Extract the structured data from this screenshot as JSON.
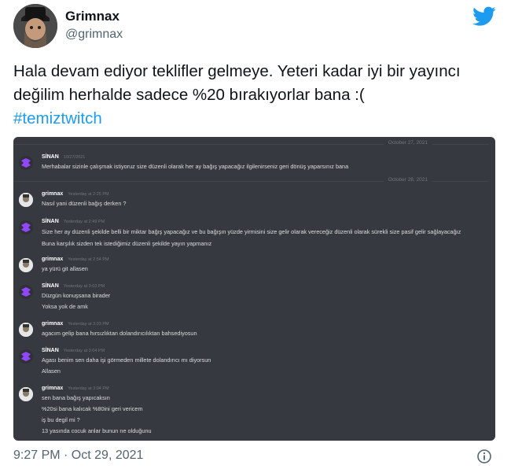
{
  "author": {
    "display_name": "Grimnax",
    "handle": "@grimnax"
  },
  "tweet": {
    "text": "Hala devam ediyor teklifler gelmeye. Yeteri kadar iyi bir yayıncı değilim herhalde sadece %20 bırakıyorlar bana :(",
    "hashtag": "#temiztwitch",
    "timestamp": "9:27 PM · Oct 29, 2021"
  },
  "discord": {
    "dividers": [
      "October 27, 2021",
      "October 28, 2021"
    ],
    "messages": [
      {
        "user": "SİNAN",
        "time": "10/27/2021",
        "lines": [
          "Merhabalar sizinle çalışmak istiyoruz size düzenli olarak her ay bağış yapacağız ilgilenirseniz geri dönüş yaparsınız bana"
        ]
      },
      {
        "user": "grimnax",
        "time": "Yesterday at 2:25 PM",
        "lines": [
          "Nasıl yani düzenli bağış derken ?"
        ]
      },
      {
        "user": "SİNAN",
        "time": "Yesterday at 2:49 PM",
        "lines": [
          "Size her ay düzenli şekilde belli bir miktar bağış yapacağız ve bu bağışın yüzde yirmisini size gelir olarak vereceğiz düzenli olarak sürekli size pasif gelir sağlayacağız",
          "Buna karşılık sizden tek istediğimiz düzenli şekilde yayın yapmanız"
        ]
      },
      {
        "user": "grimnax",
        "time": "Yesterday at 2:54 PM",
        "lines": [
          "ya yürü git allasen"
        ]
      },
      {
        "user": "SİNAN",
        "time": "Yesterday at 3:03 PM",
        "lines": [
          "Düzgün konuşsana birader",
          "Yoksa yok de amk"
        ]
      },
      {
        "user": "grimnax",
        "time": "Yesterday at 3:03 PM",
        "lines": [
          "agacım gelip bana hırsızlıktan dolandırıcılıktan bahsediyosun"
        ]
      },
      {
        "user": "SİNAN",
        "time": "Yesterday at 3:04 PM",
        "lines": [
          "Agası benim sen daha işi görmeden millete dolandırıcı mı diyorsun",
          "Allasen"
        ]
      },
      {
        "user": "grimnax",
        "time": "Yesterday at 3:04 PM",
        "lines": [
          "sen bana bağış yapıcaksın",
          "%20si bana kalıcak %80ini geri vericem",
          "iş bu degil mi ?",
          "13 yasında cocuk anlar bunun ne olduğunu"
        ]
      }
    ]
  },
  "colors": {
    "accent": "#1d9bf0",
    "discord_bg": "#36393f",
    "sinan_logo": "#9146ff"
  },
  "icons": {
    "brand": "twitter-bird-icon",
    "info": "info-icon"
  }
}
